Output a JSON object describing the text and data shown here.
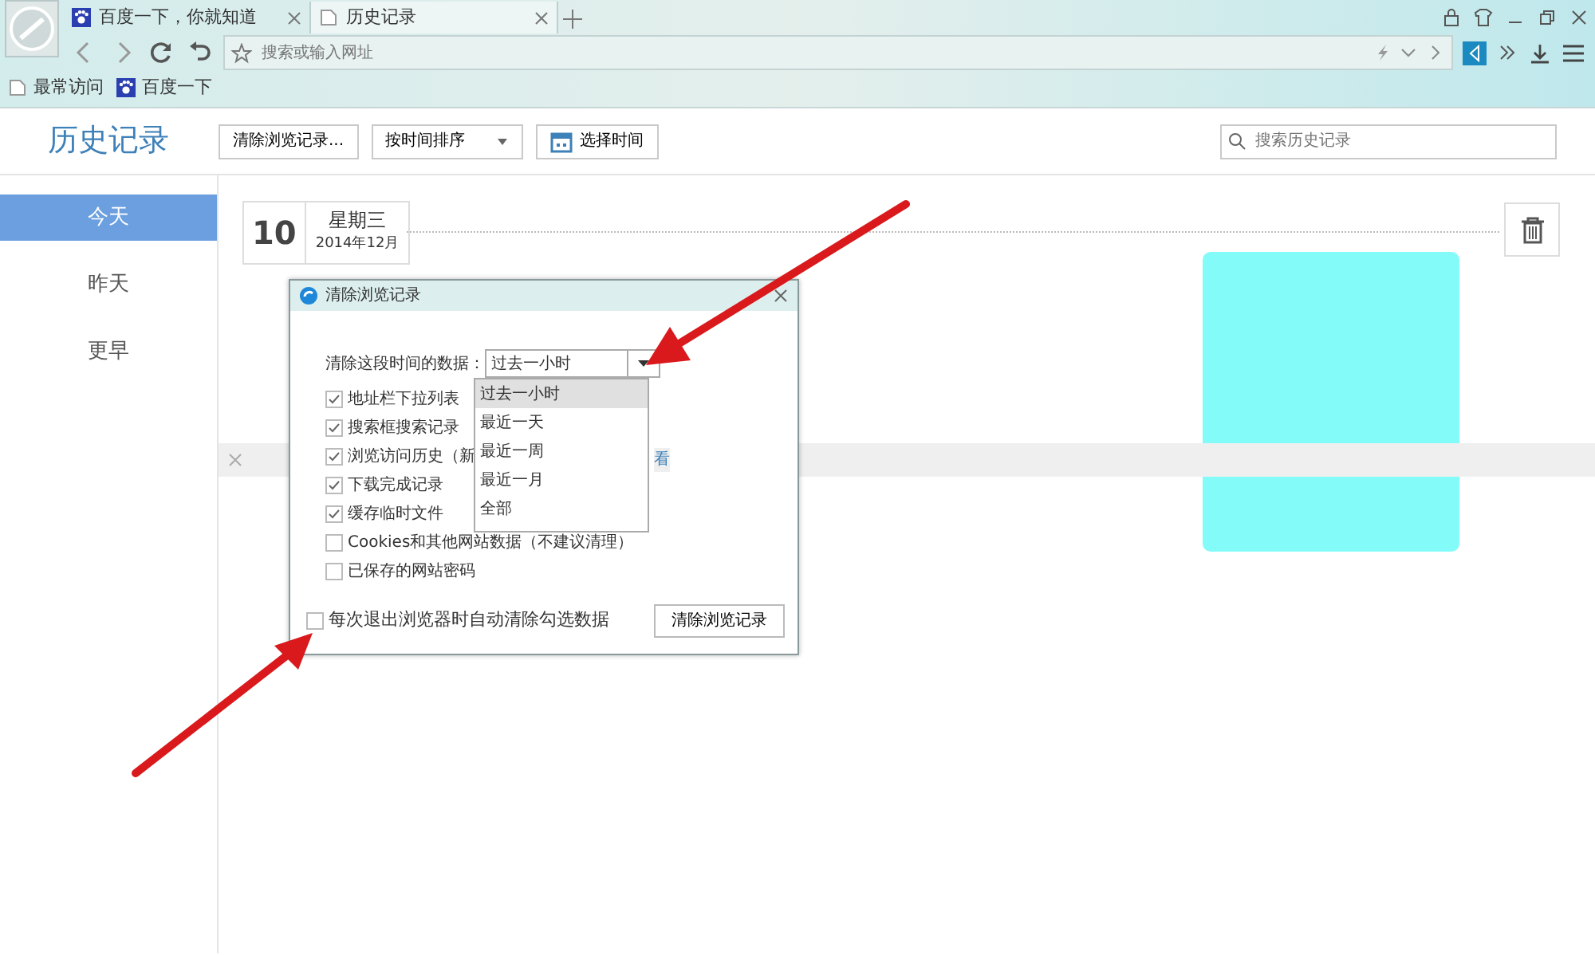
{
  "browser_tabs": [
    {
      "title": "百度一下，你就知道",
      "selected": false
    },
    {
      "title": "历史记录",
      "selected": true
    }
  ],
  "address_bar": {
    "placeholder": "搜索或输入网址"
  },
  "bookmarks": [
    {
      "label": "最常访问"
    },
    {
      "label": "百度一下"
    }
  ],
  "page_header": {
    "title": "历史记录",
    "buttons": [
      {
        "label": "清除浏览记录...",
        "kind": "plain"
      },
      {
        "label": "按时间排序",
        "kind": "dropdown"
      },
      {
        "label": "选择时间",
        "kind": "calendar"
      }
    ],
    "search": {
      "placeholder": "搜索历史记录"
    }
  },
  "sidebar": {
    "items": [
      {
        "label": "今天",
        "selected": true
      },
      {
        "label": "昨天",
        "selected": false
      },
      {
        "label": "更早",
        "selected": false
      }
    ]
  },
  "day": {
    "date": "10",
    "weekday": "星期三",
    "month": "2014年12月",
    "link_fragment": "看"
  },
  "dialog": {
    "title": "清除浏览记录",
    "range_label": "清除这段时间的数据：",
    "range_value": "过去一小时",
    "options": [
      {
        "label": "地址栏下拉列表",
        "checked": true
      },
      {
        "label": "搜索框搜索记录",
        "checked": true
      },
      {
        "label": "浏览访问历史（新",
        "checked": true
      },
      {
        "label": "下载完成记录",
        "checked": true
      },
      {
        "label": "缓存临时文件",
        "checked": true
      },
      {
        "label": "Cookies和其他网站数据（不建议清理）",
        "checked": false
      },
      {
        "label": "已保存的网站密码",
        "checked": false
      }
    ],
    "auto_clear": {
      "label": "每次退出浏览器时自动清除勾选数据",
      "checked": false
    },
    "button": "清除浏览记录",
    "dropdown": [
      {
        "label": "过去一小时",
        "selected": true
      },
      {
        "label": "最近一天",
        "selected": false
      },
      {
        "label": "最近一周",
        "selected": false
      },
      {
        "label": "最近一月",
        "selected": false
      },
      {
        "label": "全部",
        "selected": false
      }
    ]
  }
}
